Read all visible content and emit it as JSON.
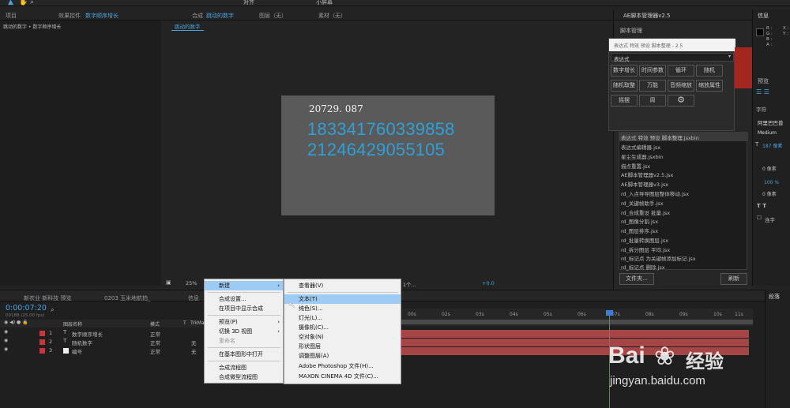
{
  "tabs_top": {
    "project": "项目",
    "effects_prefix": "效果控件",
    "effects_name": "数字顺序增长",
    "comp_prefix": "合成",
    "comp_name": "跳动的数字",
    "layer": "图层（无）",
    "footage": "素材（无）",
    "breadcrumb": "跳动的数字 • 数字顺序增长",
    "comp_subtab": "跳动的数字"
  },
  "toolbar": {
    "snap_label": "对齐",
    "small_screen": "小屏幕"
  },
  "viewer": {
    "line1": "20729. 087",
    "line2": "183341760339858",
    "line3": "21246429055105",
    "zoom": "25%",
    "extra": "1个...",
    "exposure": "+0.0"
  },
  "context_menu": {
    "items": [
      "新建",
      "合成设置...",
      "在项目中显示合成",
      "预览(P)",
      "切换 3D 视图",
      "重命名",
      "在基本图形中打开",
      "合成流程图",
      "合成微型流程图"
    ],
    "submenu": [
      "查看器(V)",
      "文本(T)",
      "纯色(S)...",
      "灯光(L)...",
      "摄像机(C)...",
      "空对象(N)",
      "形状图层",
      "调整图层(A)",
      "Adobe Photoshop 文件(H)...",
      "MAXON CINEMA 4D 文件(C)..."
    ]
  },
  "script_manager": {
    "title": "AE脚本管理器v2.5",
    "label": "脚本管理",
    "dialog_title": "表达式 特效 预设 脚本整理 - 2.5",
    "dropdown": "表达式",
    "buttons": [
      "数字增长",
      "时间参数",
      "循环",
      "随机",
      "随机取整",
      "万能",
      "音频缩放",
      "缩放属性",
      "摇摆",
      "周"
    ],
    "list": [
      "表达式 特效 预设 脚本整理.jsxbin",
      "表达式编辑器.jsx",
      "星尘生成器.jsxbin",
      "描点重置.jsx",
      "AE脚本管理器v2.5.jsx",
      "AE脚本管理器v3.jsx",
      "rd_入点导导图层整体移动.jsx",
      "rd_关键帧助手.jsx",
      "rd_合成重设 批量.jsx",
      "rd_图像分割.jsx",
      "rd_图层排序.jsx",
      "rd_批量转换图层.jsx",
      "rd_拆分图层 平均.jsx",
      "rd_标记点 为关键帧添加标记.jsx",
      "rd_标记点 删除.jsx"
    ],
    "folder_btn": "文件夹...",
    "refresh_btn": "刷新"
  },
  "info_panel": {
    "title": "信息",
    "r": "R :",
    "g": "G :",
    "b": "B :",
    "a": "A :",
    "x": "X :",
    "y": "Y :"
  },
  "char_panel": {
    "preview_tab": "预览",
    "char_tab": "字符",
    "font": "阿里巴巴普",
    "weight": "Medium",
    "size": "187 像素",
    "tracking": "0 像素",
    "scale": "100 %",
    "baseline": "0 像素",
    "ligature": "连字"
  },
  "timeline": {
    "tabs": [
      "新农业 新科技 预览",
      "0203 玉米地航拍_",
      "信息"
    ],
    "timecode": "0:00:07:20",
    "subtimecode": "00188 (25.00 fps)",
    "col_headers": [
      "图层名称",
      "模式",
      "T",
      "TrkMat"
    ],
    "layers": [
      {
        "num": "1",
        "name": "数字顺序增长",
        "mode": "正常",
        "trk": ""
      },
      {
        "num": "2",
        "name": "随机数字",
        "mode": "正常",
        "trk": "无"
      },
      {
        "num": "3",
        "name": "编号",
        "mode": "正常",
        "trk": "无"
      }
    ],
    "ruler": [
      "00s",
      "02s",
      "03s",
      "04s",
      "05s",
      "06s",
      "07s",
      "08s",
      "09s",
      "10s",
      "11s",
      "12"
    ],
    "right_title": "段落"
  },
  "watermark": {
    "brand": "Bai",
    "brand_cn": "经验",
    "url": "jingyan.baidu.com"
  },
  "colors": {
    "accent": "#4aa3e0",
    "layer_red": "#a64545",
    "playhead": "#3a7de0",
    "viewer_text": "#2f9fd8"
  }
}
